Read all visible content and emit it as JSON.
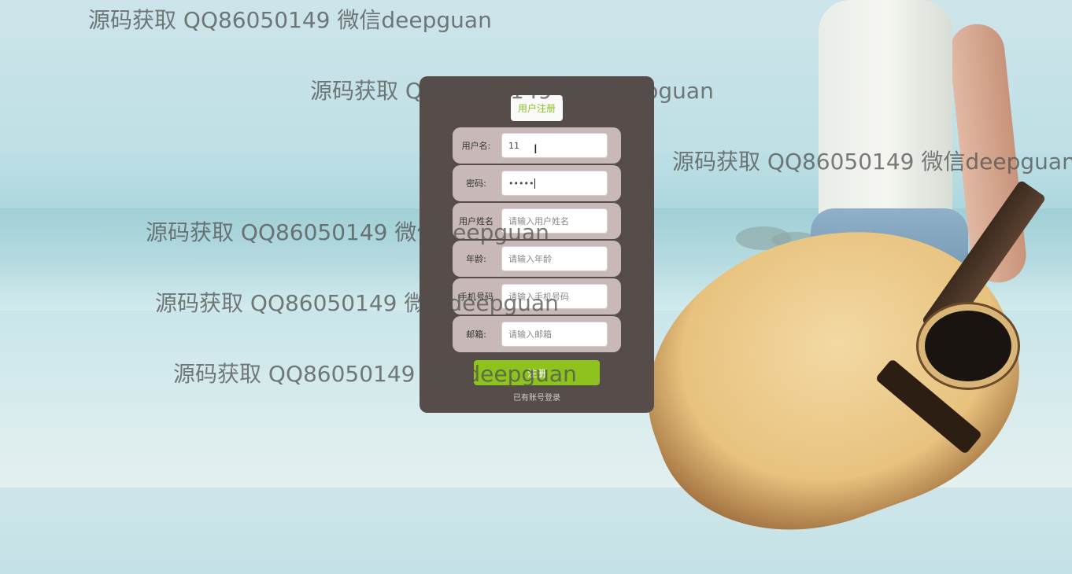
{
  "form": {
    "title": "用户注册",
    "fields": [
      {
        "label": "用户名:",
        "value": "11",
        "placeholder": ""
      },
      {
        "label": "密码:",
        "value": "•••••",
        "placeholder": ""
      },
      {
        "label": "用户姓名",
        "value": "",
        "placeholder": "请输入用户姓名"
      },
      {
        "label": "年龄:",
        "value": "",
        "placeholder": "请输入年龄"
      },
      {
        "label": "手机号码",
        "value": "",
        "placeholder": "请输入手机号码"
      },
      {
        "label": "邮箱:",
        "value": "",
        "placeholder": "请输入邮箱"
      }
    ],
    "submit_label": "注册",
    "login_link": "已有账号登录"
  },
  "watermarks": [
    "源码获取 QQ86050149 微信deepguan",
    "源码获取 QQ86050149 微信deepguan",
    "源码获取 QQ86050149 微信deepguan",
    "源码获取 QQ86050149 微信deepguan",
    "源码获取 QQ86050149 微信deepguan",
    "源码获取 QQ86050149 微信deepguan"
  ],
  "colors": {
    "card": "#564c4a",
    "row": "#c8b8b8",
    "accent": "#8dc21f"
  }
}
